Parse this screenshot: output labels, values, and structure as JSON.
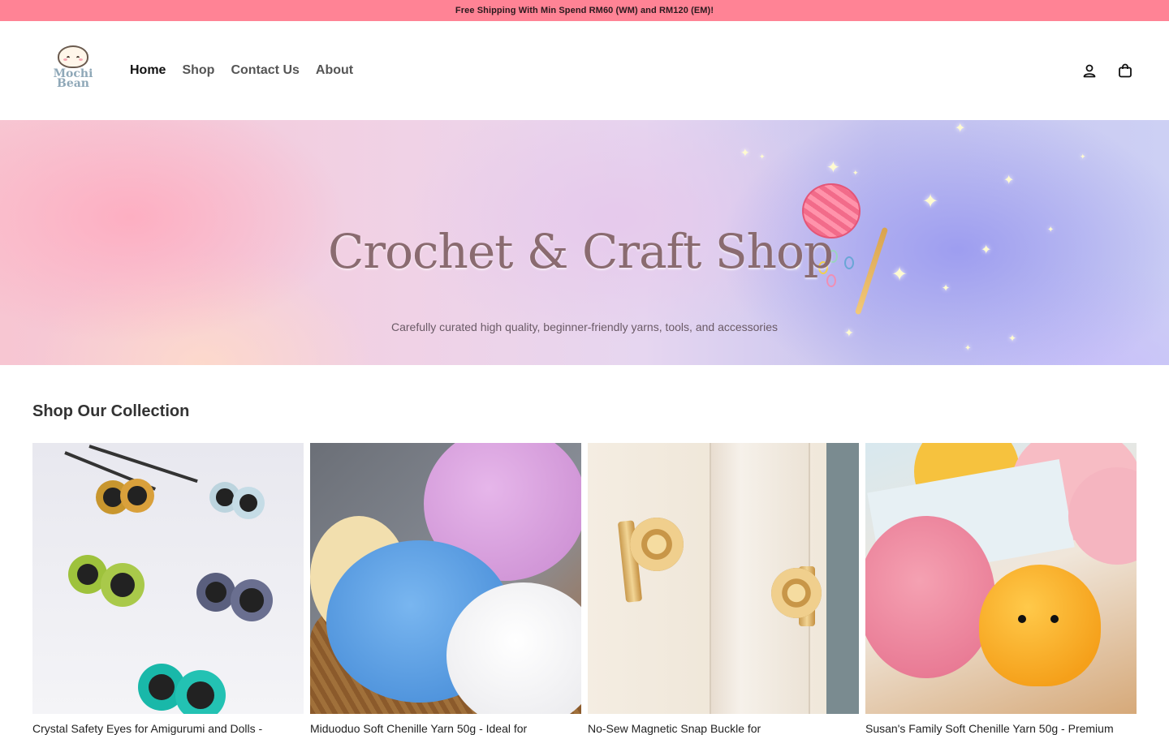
{
  "announcement": "Free Shipping With Min Spend RM60 (WM) and RM120 (EM)!",
  "brand": {
    "line1": "Mochi",
    "line2": "Bean"
  },
  "nav": [
    {
      "label": "Home",
      "active": true
    },
    {
      "label": "Shop",
      "active": false
    },
    {
      "label": "Contact Us",
      "active": false
    },
    {
      "label": "About",
      "active": false
    }
  ],
  "header_icons": [
    "account-icon",
    "cart-icon"
  ],
  "hero": {
    "title": "Crochet & Craft Shop",
    "subtitle": "Carefully curated high quality, beginner-friendly yarns, tools, and accessories"
  },
  "collection": {
    "title": "Shop Our Collection",
    "products": [
      {
        "title": "Crystal Safety Eyes for Amigurumi and Dolls -"
      },
      {
        "title": "Miduoduo Soft Chenille Yarn 50g - Ideal for"
      },
      {
        "title": "No-Sew Magnetic Snap Buckle for"
      },
      {
        "title": "Susan's Family Soft Chenille Yarn 50g - Premium"
      }
    ]
  },
  "colors": {
    "announcement_bg": "#ff8395",
    "text": "#222222"
  }
}
